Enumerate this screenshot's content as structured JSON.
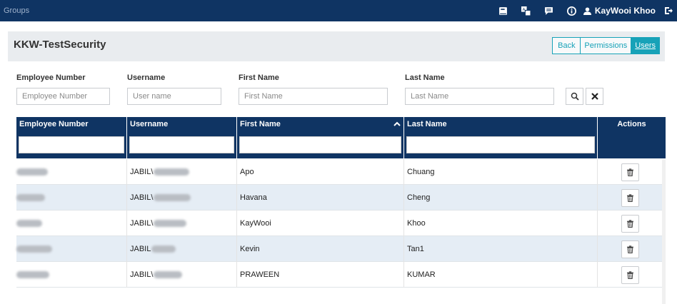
{
  "topbar": {
    "brand": "Groups",
    "user_name": "KayWooi Khoo"
  },
  "page": {
    "title": "KKW-TestSecurity"
  },
  "buttons": {
    "back": "Back",
    "permissions": "Permissions",
    "users": "Users"
  },
  "filters": {
    "employee_number": {
      "label": "Employee Number",
      "placeholder": "Employee Number"
    },
    "username": {
      "label": "Username",
      "placeholder": "User name"
    },
    "first_name": {
      "label": "First Name",
      "placeholder": "First Name"
    },
    "last_name": {
      "label": "Last Name",
      "placeholder": "Last Name"
    }
  },
  "grid": {
    "columns": [
      "Employee Number",
      "Username",
      "First Name",
      "Last Name",
      "Actions"
    ],
    "sorted_column": "First Name",
    "sort_direction": "ascending",
    "rows": [
      {
        "employee_number": "",
        "username_prefix": "JABIL\\",
        "first_name": "Apo",
        "last_name": "Chuang"
      },
      {
        "employee_number": "",
        "username_prefix": "JABIL\\",
        "first_name": "Havana",
        "last_name": "Cheng"
      },
      {
        "employee_number": "",
        "username_prefix": "JABIL\\",
        "first_name": "KayWooi",
        "last_name": "Khoo"
      },
      {
        "employee_number": "",
        "username_prefix": "JABIL",
        "first_name": "Kevin",
        "last_name": "Tan1"
      },
      {
        "employee_number": "",
        "username_prefix": "JABIL\\",
        "first_name": "PRAWEEN",
        "last_name": "KUMAR"
      }
    ]
  },
  "colors": {
    "header_bg": "#0f3463",
    "accent": "#17a2b8",
    "alt_row": "#e5edf5"
  }
}
